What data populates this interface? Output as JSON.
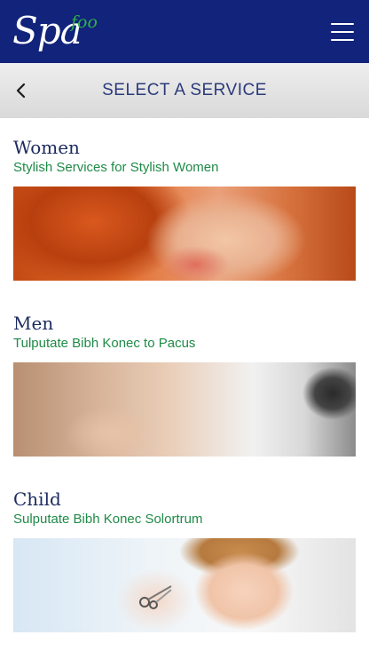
{
  "app": {
    "logo_main": "Spa",
    "logo_accent": "foo"
  },
  "header": {
    "title": "SELECT A SERVICE"
  },
  "icons": {
    "menu": "hamburger-menu-icon",
    "back": "chevron-left-icon"
  },
  "colors": {
    "topbar": "#11237a",
    "accent": "#2fb34a",
    "title": "#2b3a7a",
    "subtitle": "#1f8a47"
  },
  "services": [
    {
      "title": "Women",
      "subtitle": "Stylish Services for Stylish Women"
    },
    {
      "title": "Men",
      "subtitle": "Tulputate Bibh Konec to Pacus"
    },
    {
      "title": "Child",
      "subtitle": "Sulputate Bibh Konec Solortrum"
    }
  ]
}
